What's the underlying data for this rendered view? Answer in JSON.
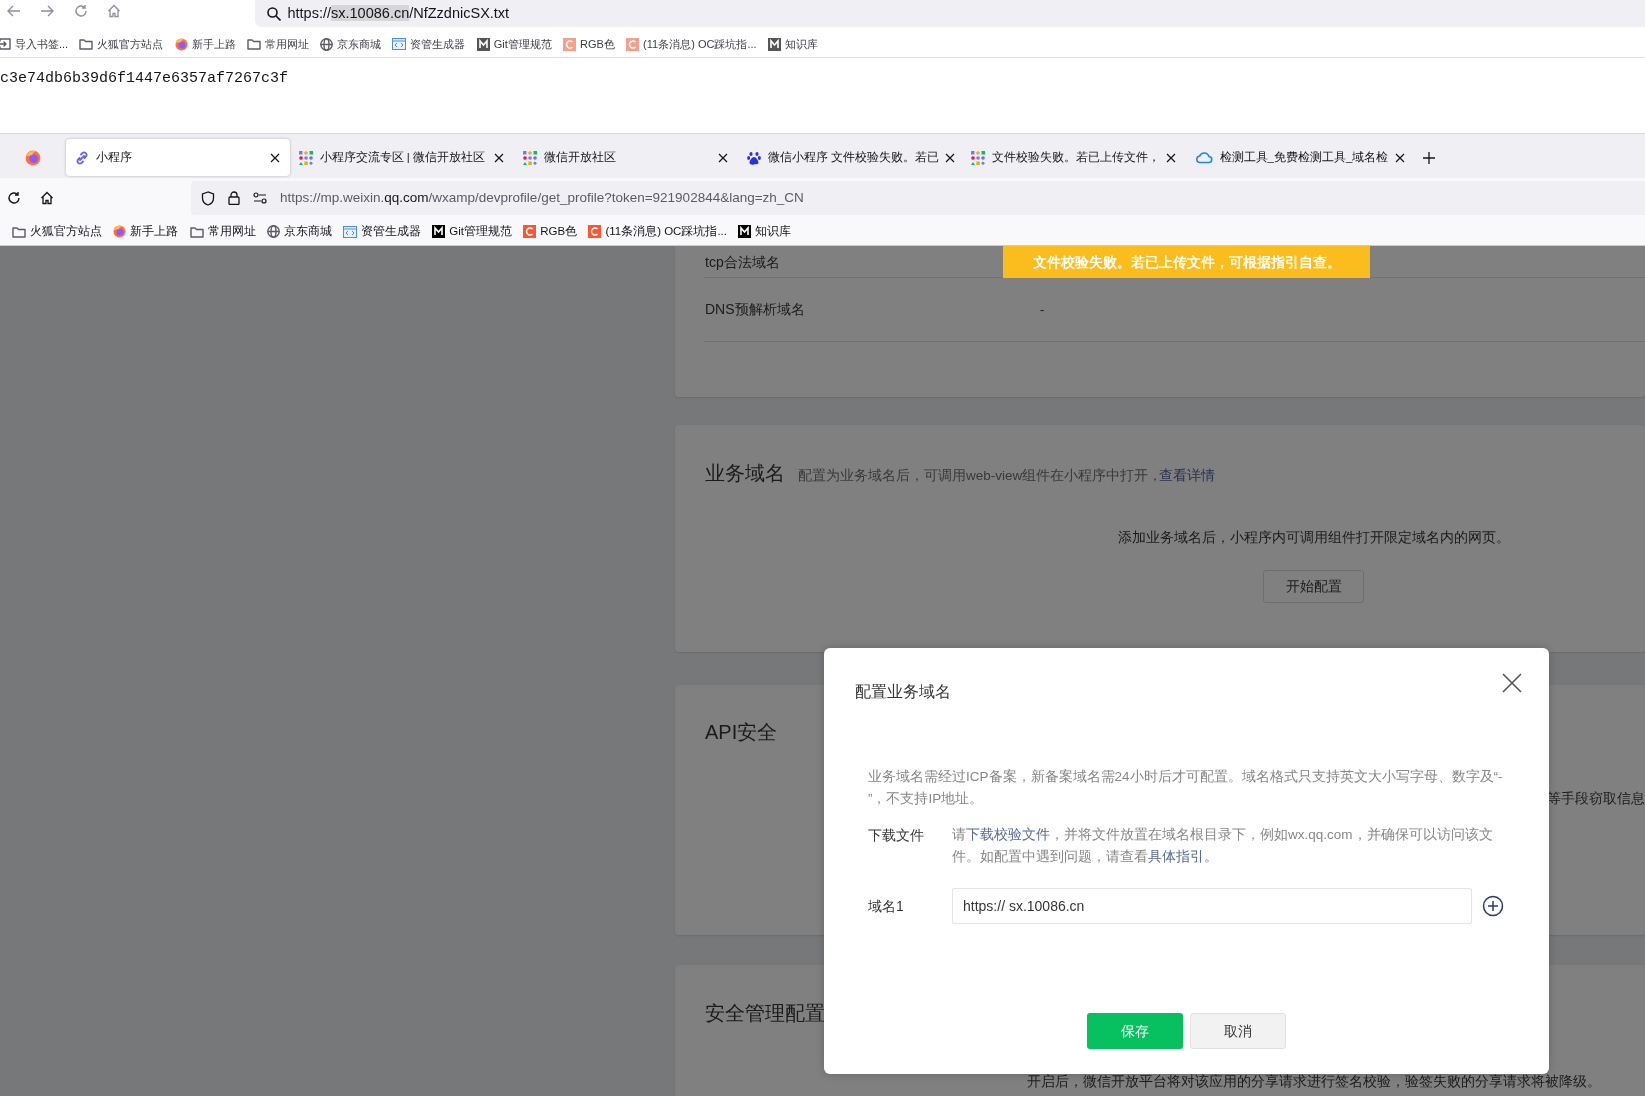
{
  "top_window": {
    "address": {
      "before": "https://",
      "selected": "sx.10086.cn",
      "after": "/NfZzdnicSX.txt"
    },
    "bookmarks": [
      {
        "kind": "import",
        "label": "导入书签..."
      },
      {
        "kind": "folder",
        "label": "火狐官方站点"
      },
      {
        "kind": "firefox",
        "label": "新手上路"
      },
      {
        "kind": "folder",
        "label": "常用网址"
      },
      {
        "kind": "globe",
        "label": "京东商城"
      },
      {
        "kind": "code",
        "label": "资管生成器"
      },
      {
        "kind": "m",
        "label": "Git管理规范"
      },
      {
        "kind": "c",
        "label": "RGB色"
      },
      {
        "kind": "c",
        "label": "(11条消息) OC踩坑指..."
      },
      {
        "kind": "m",
        "label": "知识库"
      }
    ],
    "content": "c3e74db6b39d6f1447e6357af7267c3f"
  },
  "bottom_window": {
    "tabs": [
      {
        "kind": "link",
        "label": "小程序",
        "selected": true
      },
      {
        "kind": "grid",
        "label": "小程序交流专区 | 微信开放社区",
        "selected": false
      },
      {
        "kind": "grid",
        "label": "微信开放社区",
        "selected": false
      },
      {
        "kind": "paw",
        "label": "微信小程序 文件校验失败。若已",
        "selected": false
      },
      {
        "kind": "grid",
        "label": "文件校验失败。若已上传文件，",
        "selected": false
      },
      {
        "kind": "cloud",
        "label": "检测工具_免费检测工具_域名检",
        "selected": false
      }
    ],
    "address": {
      "before": "https://mp.weixin.",
      "domain": "qq.com",
      "after": "/wxamp/devprofile/get_profile?token=921902844&lang=zh_CN"
    },
    "bookmarks": [
      {
        "kind": "folder",
        "label": "火狐官方站点"
      },
      {
        "kind": "firefox",
        "label": "新手上路"
      },
      {
        "kind": "folder",
        "label": "常用网址"
      },
      {
        "kind": "globe",
        "label": "京东商城"
      },
      {
        "kind": "code",
        "label": "资管生成器"
      },
      {
        "kind": "m",
        "label": "Git管理规范"
      },
      {
        "kind": "c",
        "label": "RGB色"
      },
      {
        "kind": "c",
        "label": "(11条消息) OC踩坑指..."
      },
      {
        "kind": "m",
        "label": "知识库"
      }
    ]
  },
  "toast": "文件校验失败。若已上传文件，可根据指引自查。",
  "server_domain_card": {
    "rows": [
      {
        "label": "tcp合法域名"
      },
      {
        "label": "DNS预解析域名",
        "value": "-"
      }
    ]
  },
  "business_domain_card": {
    "title": "业务域名",
    "description": "配置为业务域名后，可调用web-view组件在小程序中打开，",
    "link": "查看详情",
    "empty_text": "添加业务域名后，小程序内可调用组件打开限定域名内的网页。",
    "button": "开始配置"
  },
  "api_card": {
    "title": "API安全",
    "side_text": "等手段窃取信息"
  },
  "security_card": {
    "title": "安全管理配置",
    "text": "开启后，微信开放平台将对该应用的分享请求进行签名校验，验签失败的分享请求将被降级。"
  },
  "dialog": {
    "title": "配置业务域名",
    "notice": "业务域名需经过ICP备案，新备案域名需24小时后才可配置。域名格式只支持英文大小写字母、数字及“- ”，不支持IP地址。",
    "download": {
      "label": "下载文件",
      "parts": [
        {
          "kind": "text",
          "text": "请"
        },
        {
          "kind": "link",
          "text": "下载校验文件"
        },
        {
          "kind": "text",
          "text": "，并将文件放置在域名根目录下，例如wx.qq.com，并确保可以访问该文件。如配置中遇到问题，请查看"
        },
        {
          "kind": "link",
          "text": "具体指引。"
        }
      ]
    },
    "domains": [
      {
        "label": "域名1",
        "value": "https:// sx.10086.cn"
      }
    ],
    "buttons": [
      {
        "kind": "primary",
        "label": "保存"
      },
      {
        "kind": "secondary",
        "label": "取消"
      }
    ]
  }
}
